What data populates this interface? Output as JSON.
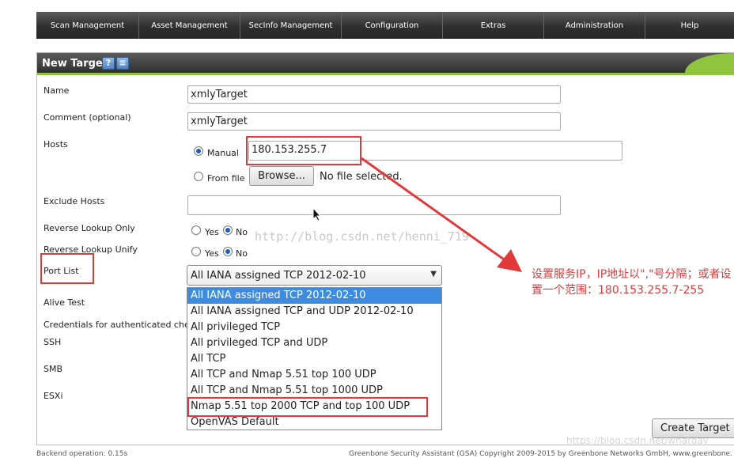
{
  "nav": {
    "items": [
      "Scan Management",
      "Asset Management",
      "SecInfo Management",
      "Configuration",
      "Extras",
      "Administration",
      "Help"
    ]
  },
  "panel": {
    "title": "New Target",
    "help_icon": "?",
    "list_icon": "≡"
  },
  "form": {
    "name_label": "Name",
    "name_value": "xmlyTarget",
    "comment_label": "Comment (optional)",
    "comment_value": "xmlyTarget",
    "hosts_label": "Hosts",
    "manual_label": "Manual",
    "hosts_value": "180.153.255.7",
    "from_file_label": "From file",
    "browse_label": "Browse...",
    "no_file_label": "No file selected.",
    "exclude_label": "Exclude Hosts",
    "exclude_value": "",
    "rlo_label": "Reverse Lookup Only",
    "rlu_label": "Reverse Lookup Unify",
    "yes_label": "Yes",
    "no_label": "No",
    "port_list_label": "Port List",
    "port_list_value": "All IANA assigned TCP 2012-02-10",
    "alive_label": "Alive Test",
    "creds_label": "Credentials for authenticated chec",
    "ssh_label": "SSH",
    "smb_label": "SMB",
    "esxi_label": "ESXi",
    "create_label": "Create Target"
  },
  "port_options": [
    "All IANA assigned TCP 2012-02-10",
    "All IANA assigned TCP and UDP 2012-02-10",
    "All privileged TCP",
    "All privileged TCP and UDP",
    "All TCP",
    "All TCP and Nmap 5.51 top 100 UDP",
    "All TCP and Nmap 5.51 top 1000 UDP",
    "Nmap 5.51 top 2000 TCP and top 100 UDP",
    "OpenVAS Default"
  ],
  "annotation": {
    "text": "设置服务IP，IP地址以\",\"号分隔；或者设置一个范围：180.153.255.7-255",
    "color": "#e23a3a"
  },
  "watermark": "http://blog.csdn.net/henni_719",
  "watermark2": "https://blog.csdn.net/whatday",
  "footer": {
    "left": "Backend operation: 0.15s",
    "right": "Greenbone Security Assistant (GSA) Copyright 2009-2015 by Greenbone Networks GmbH, www.greenbone."
  }
}
